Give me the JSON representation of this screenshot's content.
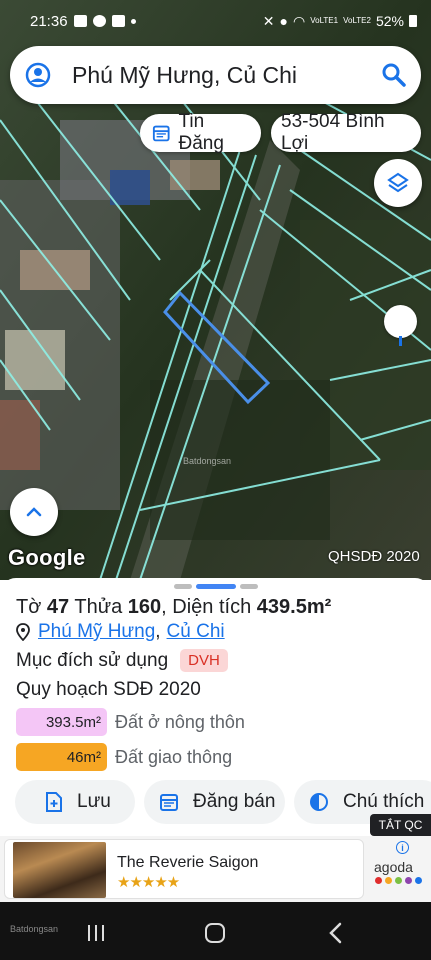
{
  "status_bar": {
    "time": "21:36",
    "carrier1": "VoLTE1",
    "carrier2": "VoLTE2",
    "battery": "52%"
  },
  "search": {
    "query": "Phú Mỹ Hưng, Củ Chi"
  },
  "chips": {
    "tin_dang": "Tin Đăng",
    "code": "53-504 Bình Lợi"
  },
  "map": {
    "google_label": "Google",
    "layer_label": "QHSDĐ 2020",
    "watermark": "Batdongsan"
  },
  "parcel": {
    "to_label": "Tờ",
    "to_value": "47",
    "thua_label": "Thửa",
    "thua_value": "160",
    "area_label": ", Diện tích",
    "area_value": "439.5m²",
    "commune": "Phú Mỹ Hưng",
    "separator": ",",
    "district": "Củ Chi",
    "purpose_label": "Mục đích sử dụng",
    "purpose_code": "DVH",
    "plan_label": "Quy hoạch SDĐ 2020",
    "zones": [
      {
        "area": "393.5m²",
        "label": "Đất ở nông thôn",
        "color": "#f4c6f6"
      },
      {
        "area": "46m²",
        "label": "Đất giao thông",
        "color": "#f6a623"
      }
    ]
  },
  "actions": {
    "save": "Lưu",
    "post": "Đăng bán",
    "note": "Chú thích"
  },
  "ad": {
    "close_label": "TẮT QC",
    "hotel_name": "The Reverie Saigon",
    "stars": "★★★★★",
    "brand": "agoda"
  },
  "nav": {
    "watermark": "Batdongsan"
  },
  "colors": {
    "accent": "#1a73e8",
    "parcel_outline": "#4a8fe8",
    "map_lines": "#8ff0e6"
  }
}
